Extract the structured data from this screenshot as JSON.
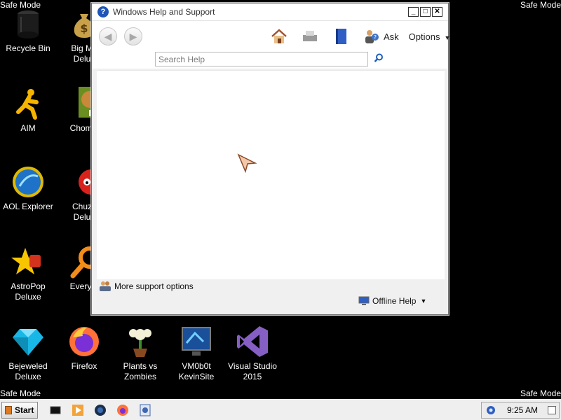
{
  "safe_mode": "Safe Mode",
  "desktop": {
    "icons": [
      {
        "label": "Recycle Bin"
      },
      {
        "label": "Big Mo\nDelux"
      },
      {
        "label": "AIM"
      },
      {
        "label": "Chomik"
      },
      {
        "label": "AOL Explorer"
      },
      {
        "label": "Chuzz\nDelux"
      },
      {
        "label": "AstroPop\nDeluxe"
      },
      {
        "label": "Everyth"
      },
      {
        "label": "Bejeweled\nDeluxe"
      },
      {
        "label": "Firefox"
      },
      {
        "label": "Plants vs\nZombies"
      },
      {
        "label": "VM0b0t\nKevinSite"
      },
      {
        "label": "Visual Studio\n2015"
      }
    ]
  },
  "help_window": {
    "title": "Windows Help and Support",
    "help_glyph": "?",
    "toolbar": {
      "ask_label": "Ask",
      "options_label": "Options"
    },
    "search": {
      "placeholder": "Search Help"
    },
    "more_support_label": "More support options",
    "offline_help_label": "Offline Help"
  },
  "taskbar": {
    "start_label": "Start",
    "clock": "9:25 AM"
  },
  "colors": {
    "desktop_bg": "#000000",
    "window_bg": "#f0f0f0",
    "taskbar_bg": "#efefef"
  }
}
